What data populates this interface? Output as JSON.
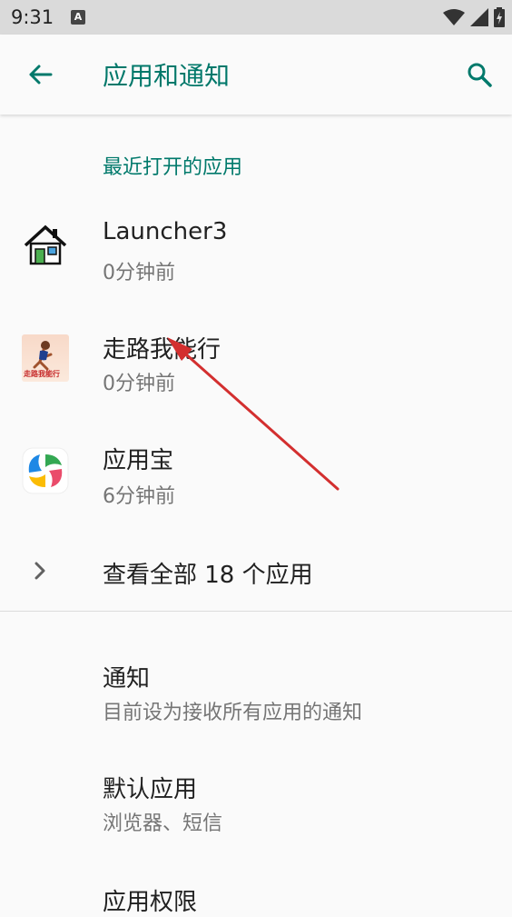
{
  "status_bar": {
    "time": "9:31",
    "a_badge": "A"
  },
  "app_bar": {
    "title": "应用和通知"
  },
  "recent": {
    "header": "最近打开的应用",
    "apps": [
      {
        "name": "Launcher3",
        "time": "0分钟前",
        "icon": "launcher-house-icon"
      },
      {
        "name": "走路我能行",
        "time": "0分钟前",
        "icon": "walking-app-icon",
        "icon_text": "走路我能行"
      },
      {
        "name": "应用宝",
        "time": "6分钟前",
        "icon": "yingyongbao-icon"
      }
    ],
    "see_all": "查看全部 18 个应用"
  },
  "settings": [
    {
      "title": "通知",
      "sub": "目前设为接收所有应用的通知"
    },
    {
      "title": "默认应用",
      "sub": "浏览器、短信"
    },
    {
      "title": "应用权限"
    }
  ],
  "colors": {
    "accent": "#00796b",
    "arrow": "#d32f2f"
  }
}
